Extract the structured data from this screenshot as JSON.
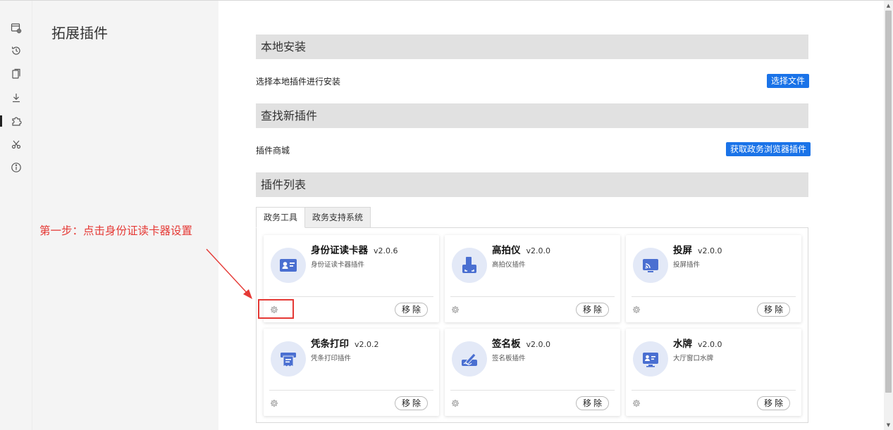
{
  "sidebar": {
    "title": "拓展插件",
    "rail_icons": [
      "window-settings-icon",
      "history-icon",
      "bookmark-icon",
      "download-icon",
      "puzzle-icon",
      "tools-icon",
      "info-icon"
    ]
  },
  "annotation": {
    "text": "第一步：点击身份证读卡器设置"
  },
  "local_install": {
    "header": "本地安装",
    "label": "选择本地插件进行安装",
    "button": "选择文件"
  },
  "find_plugins": {
    "header": "查找新插件",
    "label": "插件商城",
    "button": "获取政务浏览器插件"
  },
  "plugin_list": {
    "header": "插件列表",
    "tabs": [
      {
        "label": "政务工具",
        "active": true
      },
      {
        "label": "政务支持系统",
        "active": false
      }
    ],
    "cards": [
      {
        "name": "身份证读卡器",
        "version": "v2.0.6",
        "desc": "身份证读卡器插件",
        "icon": "id-card-icon",
        "remove": "移除"
      },
      {
        "name": "高拍仪",
        "version": "v2.0.0",
        "desc": "高拍仪插件",
        "icon": "scanner-icon",
        "remove": "移除"
      },
      {
        "name": "投屏",
        "version": "v2.0.0",
        "desc": "投屏插件",
        "icon": "cast-icon",
        "remove": "移除"
      },
      {
        "name": "凭条打印",
        "version": "v2.0.2",
        "desc": "凭条打印插件",
        "icon": "receipt-printer-icon",
        "remove": "移除"
      },
      {
        "name": "签名板",
        "version": "v2.0.0",
        "desc": "签名板插件",
        "icon": "signature-pad-icon",
        "remove": "移除"
      },
      {
        "name": "水牌",
        "version": "v2.0.0",
        "desc": "大厅窗口水牌",
        "icon": "display-board-icon",
        "remove": "移除"
      }
    ]
  },
  "colors": {
    "accent": "#1a73e8",
    "annotation": "#e53935",
    "icon_fg": "#4a6fd1",
    "icon_bg": "#e3e9f7"
  }
}
